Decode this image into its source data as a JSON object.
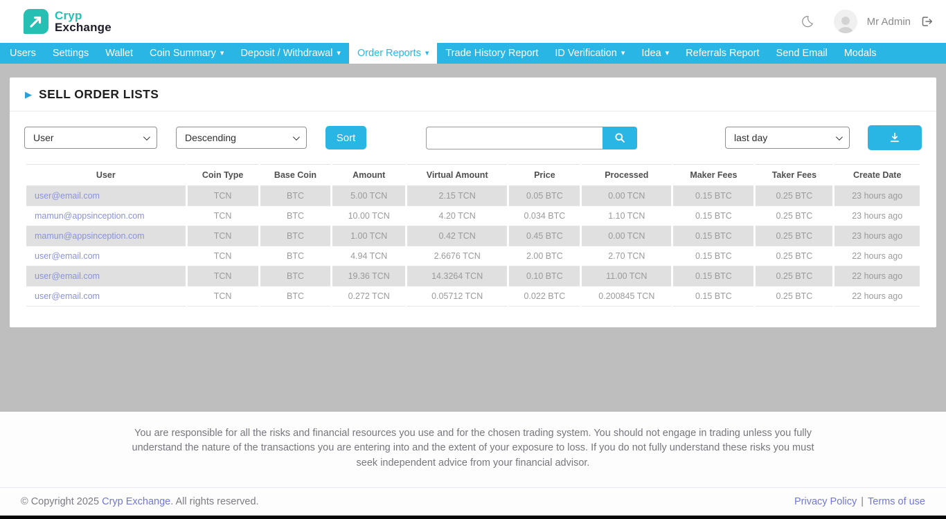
{
  "colors": {
    "accent_cyan": "#29b6e4",
    "brand_teal": "#26bfb3",
    "table_link": "#8a92dc",
    "footer_link": "#6f78d8",
    "stripe_gray": "#e0e0e0",
    "page_background": "#bebebe"
  },
  "icons": {
    "caret_down": "▾",
    "play_triangle": "▶",
    "moon": "moon-icon",
    "search": "search-icon",
    "download": "download-icon",
    "logout": "logout-icon"
  },
  "header": {
    "brand_top": "Cryp",
    "brand_bottom": "Exchange",
    "user_name": "Mr Admin"
  },
  "nav": {
    "items": [
      {
        "label": "Users"
      },
      {
        "label": "Settings"
      },
      {
        "label": "Wallet"
      },
      {
        "label": "Coin Summary"
      },
      {
        "label": "Deposit / Withdrawal"
      },
      {
        "label": "Order Reports"
      },
      {
        "label": "Trade History Report"
      },
      {
        "label": "ID Verification"
      },
      {
        "label": "Idea"
      },
      {
        "label": "Referrals Report"
      },
      {
        "label": "Send Email"
      },
      {
        "label": "Modals"
      }
    ],
    "active_item": "Order Reports"
  },
  "page": {
    "title": "SELL ORDER LISTS"
  },
  "filters": {
    "sort_field": "User",
    "sort_direction": "Descending",
    "sort_button": "Sort",
    "search_value": "",
    "date_range": "last day"
  },
  "table": {
    "columns": [
      "User",
      "Coin Type",
      "Base Coin",
      "Amount",
      "Virtual Amount",
      "Price",
      "Processed",
      "Maker Fees",
      "Taker Fees",
      "Create Date"
    ],
    "rows": [
      [
        "user@email.com",
        "TCN",
        "BTC",
        "5.00 TCN",
        "2.15 TCN",
        "0.05 BTC",
        "0.00 TCN",
        "0.15 BTC",
        "0.25 BTC",
        "23 hours ago"
      ],
      [
        "mamun@appsinception.com",
        "TCN",
        "BTC",
        "10.00 TCN",
        "4.20 TCN",
        "0.034 BTC",
        "1.10 TCN",
        "0.15 BTC",
        "0.25 BTC",
        "23 hours ago"
      ],
      [
        "mamun@appsinception.com",
        "TCN",
        "BTC",
        "1.00 TCN",
        "0.42 TCN",
        "0.45 BTC",
        "0.00 TCN",
        "0.15 BTC",
        "0.25 BTC",
        "23 hours ago"
      ],
      [
        "user@email.com",
        "TCN",
        "BTC",
        "4.94 TCN",
        "2.6676 TCN",
        "2.00 BTC",
        "2.70 TCN",
        "0.15 BTC",
        "0.25 BTC",
        "22 hours ago"
      ],
      [
        "user@email.com",
        "TCN",
        "BTC",
        "19.36 TCN",
        "14.3264 TCN",
        "0.10 BTC",
        "11.00 TCN",
        "0.15 BTC",
        "0.25 BTC",
        "22 hours ago"
      ],
      [
        "user@email.com",
        "TCN",
        "BTC",
        "0.272 TCN",
        "0.05712 TCN",
        "0.022 BTC",
        "0.200845 TCN",
        "0.15 BTC",
        "0.25 BTC",
        "22 hours ago"
      ]
    ]
  },
  "footer": {
    "disclaimer": "You are responsible for all the risks and financial resources you use and for the chosen trading system. You should not engage in trading unless you fully understand the nature of the transactions you are entering into and the extent of your exposure to loss. If you do not fully understand these risks you must seek independent advice from your financial advisor.",
    "copyright_prefix": "© Copyright 2025 ",
    "copyright_link": "Cryp Exchange",
    "copyright_suffix": ". All rights reserved.",
    "privacy_link": "Privacy Policy",
    "link_separator": "|",
    "terms_link": "Terms of use"
  }
}
